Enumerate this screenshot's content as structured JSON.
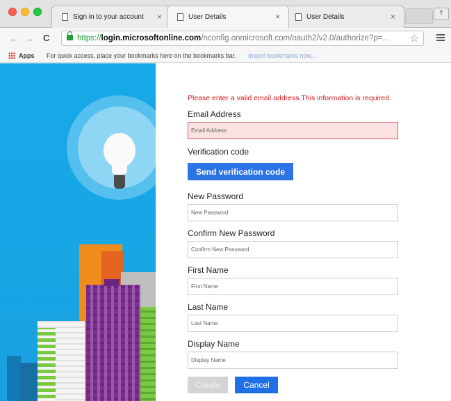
{
  "browser": {
    "tabs": [
      {
        "title": "Sign in to your account",
        "active": false
      },
      {
        "title": "User Details",
        "active": true
      },
      {
        "title": "User Details",
        "active": false
      }
    ],
    "url": {
      "scheme": "https://",
      "host": "login.microsoftonline.com",
      "path": "/nconfig.onmicrosoft.com/oauth2/v2.0/authorize?p=..."
    },
    "bookmarks": {
      "apps_label": "Apps",
      "hint": "For quick access, place your bookmarks here on the bookmarks bar.",
      "import_link": "Import bookmarks now..."
    }
  },
  "form": {
    "error_message": "Please enter a valid email address.This information is required.",
    "email": {
      "label": "Email Address",
      "placeholder": "Email Address",
      "value": ""
    },
    "verification": {
      "label": "Verification code",
      "button": "Send verification code"
    },
    "new_password": {
      "label": "New Password",
      "placeholder": "New Password"
    },
    "confirm_password": {
      "label": "Confirm New Password",
      "placeholder": "Confirm New Password"
    },
    "first_name": {
      "label": "First Name",
      "placeholder": "First Name"
    },
    "last_name": {
      "label": "Last Name",
      "placeholder": "Last Name"
    },
    "display_name": {
      "label": "Display Name",
      "placeholder": "Display Name"
    },
    "create_button": "Create",
    "cancel_button": "Cancel"
  },
  "colors": {
    "error": "#d41c1c",
    "accent": "#2c73e6",
    "hero_bg": "#17a8e8",
    "invalid_field_bg": "#fbe2e2"
  },
  "icons": {
    "page": "document-icon",
    "close": "close-icon",
    "lock": "lock-icon",
    "star": "star-icon",
    "menu": "menu-icon",
    "apps": "apps-grid-icon",
    "hero": "lightbulb-illustration"
  }
}
